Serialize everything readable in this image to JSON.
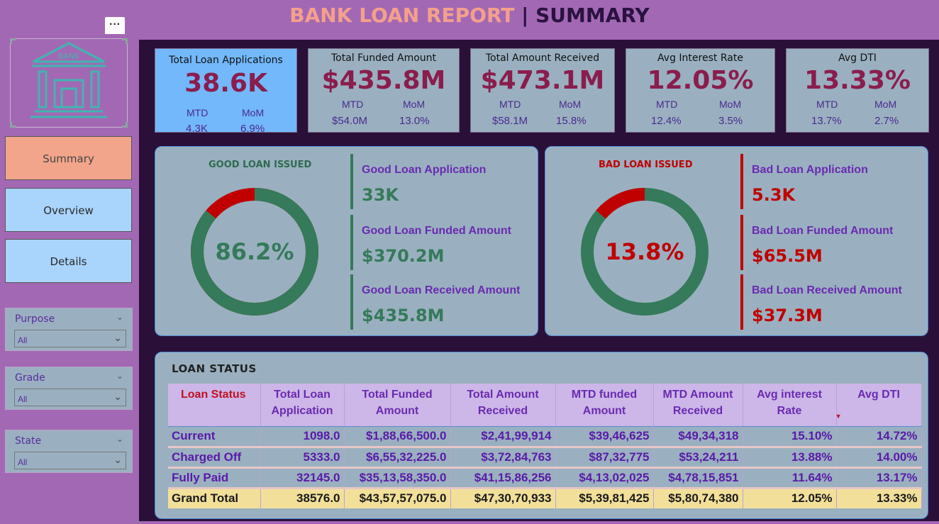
{
  "header": {
    "title_part1": "BANK LOAN REPORT",
    "separator": "|",
    "title_part2": "SUMMARY"
  },
  "sidebar": {
    "more_label": "···",
    "logo_text": "BANK",
    "nav": [
      {
        "label": "Summary",
        "active": true
      },
      {
        "label": "Overview",
        "active": false
      },
      {
        "label": "Details",
        "active": false
      }
    ],
    "filters": [
      {
        "label": "Purpose",
        "value": "All"
      },
      {
        "label": "Grade",
        "value": "All"
      },
      {
        "label": "State",
        "value": "All"
      }
    ]
  },
  "kpis": [
    {
      "label": "Total Loan Applications",
      "value": "38.6K",
      "mtd_label": "MTD",
      "mtd": "4.3K",
      "mom_label": "MoM",
      "mom": "6.9%"
    },
    {
      "label": "Total Funded Amount",
      "value": "$435.8M",
      "mtd_label": "MTD",
      "mtd": "$54.0M",
      "mom_label": "MoM",
      "mom": "13.0%"
    },
    {
      "label": "Total  Amount Received",
      "value": "$473.1M",
      "mtd_label": "MTD",
      "mtd": "$58.1M",
      "mom_label": "MoM",
      "mom": "15.8%"
    },
    {
      "label": "Avg Interest Rate",
      "value": "12.05%",
      "mtd_label": "MTD",
      "mtd": "12.4%",
      "mom_label": "MoM",
      "mom": "3.5%"
    },
    {
      "label": "Avg DTI",
      "value": "13.33%",
      "mtd_label": "MTD",
      "mtd": "13.7%",
      "mom_label": "MoM",
      "mom": "2.7%"
    }
  ],
  "good_loan": {
    "title": "GOOD LOAN ISSUED",
    "percent_label": "86.2%",
    "percent_value": 86.2,
    "title_color": "#2e6b4f",
    "main_color": "#357a5a",
    "rest_color": "#c00000",
    "metrics": [
      {
        "label": "Good Loan Application",
        "value": "33K"
      },
      {
        "label": "Good Loan Funded Amount",
        "value": "$370.2M"
      },
      {
        "label": "Good Loan Received Amount",
        "value": "$435.8M"
      }
    ]
  },
  "bad_loan": {
    "title": "BAD LOAN ISSUED",
    "percent_label": "13.8%",
    "percent_value": 13.8,
    "title_color": "#c00000",
    "main_color": "#c00000",
    "rest_color": "#357a5a",
    "metrics": [
      {
        "label": "Bad Loan Application",
        "value": "5.3K"
      },
      {
        "label": "Bad Loan Funded Amount",
        "value": "$65.5M"
      },
      {
        "label": "Bad Loan Received Amount",
        "value": "$37.3M"
      }
    ]
  },
  "loan_status": {
    "title": "LOAN  STATUS",
    "columns": [
      [
        "Loan Status"
      ],
      [
        "Total Loan",
        "Application"
      ],
      [
        "Total Funded",
        "Amount"
      ],
      [
        "Total Amount",
        "Received"
      ],
      [
        "MTD funded",
        "Amount"
      ],
      [
        "MTD Amount",
        "Received"
      ],
      [
        "Avg interest",
        "Rate"
      ],
      [
        "Avg DTI"
      ]
    ],
    "rows": [
      [
        "Current",
        "1098.0",
        "$1,88,66,500.0",
        "$2,41,99,914",
        "$39,46,625",
        "$49,34,318",
        "15.10%",
        "14.72%"
      ],
      [
        "Charged Off",
        "5333.0",
        "$6,55,32,225.0",
        "$3,72,84,763",
        "$87,32,775",
        "$53,24,211",
        "13.88%",
        "14.00%"
      ],
      [
        "Fully Paid",
        "32145.0",
        "$35,13,58,350.0",
        "$41,15,86,256",
        "$4,13,02,025",
        "$4,78,15,851",
        "11.64%",
        "13.17%"
      ]
    ],
    "total": [
      "Grand Total",
      "38576.0",
      "$43,57,57,075.0",
      "$47,30,70,933",
      "$5,39,81,425",
      "$5,80,74,380",
      "12.05%",
      "13.33%"
    ]
  },
  "colors": {
    "sidebar_bg": "#a368b4",
    "main_bg": "#2a1038",
    "card_bg": "#9ab0c0",
    "kpi_value": "#8a1d4d",
    "accent_purple": "#6a2ab0",
    "good_green": "#357a5a",
    "bad_red": "#c00000",
    "total_row": "#f2e09a"
  }
}
